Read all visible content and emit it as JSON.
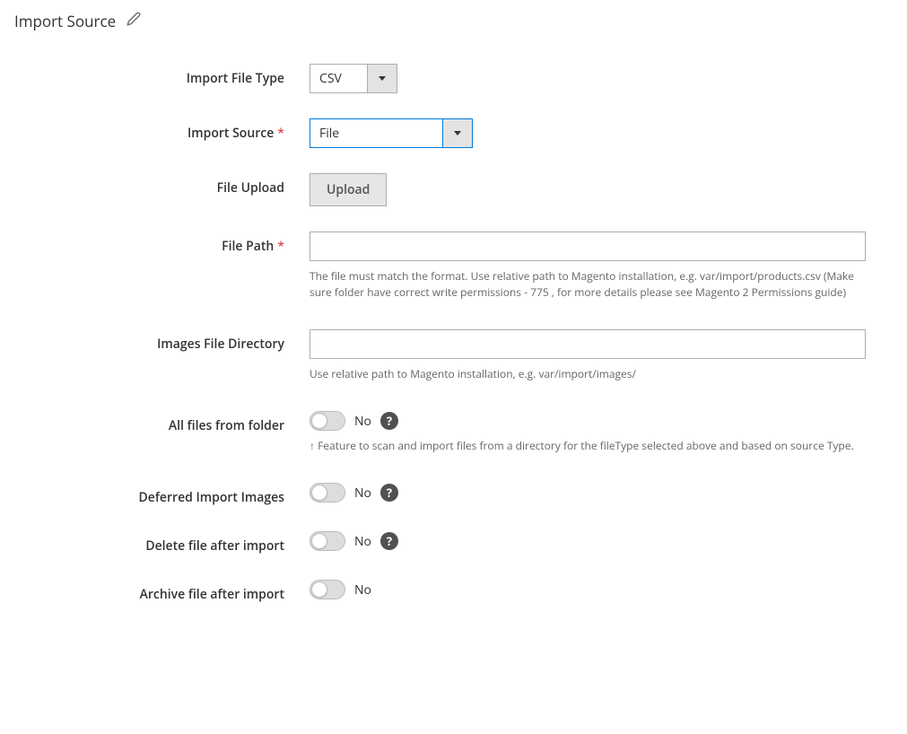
{
  "section": {
    "title": "Import Source"
  },
  "fields": {
    "file_type": {
      "label": "Import File Type",
      "value": "CSV"
    },
    "import_source": {
      "label": "Import Source",
      "value": "File"
    },
    "file_upload": {
      "label": "File Upload",
      "button": "Upload"
    },
    "file_path": {
      "label": "File Path",
      "value": "",
      "note": "The file must match the format. Use relative path to Magento installation, e.g. var/import/products.csv (Make sure folder have correct write permissions - 775 , for more details please see Magento 2 Permissions guide)"
    },
    "images_dir": {
      "label": "Images File Directory",
      "value": "",
      "note": "Use relative path to Magento installation, e.g. var/import/images/"
    },
    "all_files": {
      "label": "All files from folder",
      "status": "No",
      "note": "↑ Feature to scan and import files from a directory for the fileType selected above and based on source Type."
    },
    "deferred": {
      "label": "Deferred Import Images",
      "status": "No"
    },
    "delete_after": {
      "label": "Delete file after import",
      "status": "No"
    },
    "archive_after": {
      "label": "Archive file after import",
      "status": "No"
    }
  },
  "help_glyph": "?",
  "required_glyph": "*"
}
